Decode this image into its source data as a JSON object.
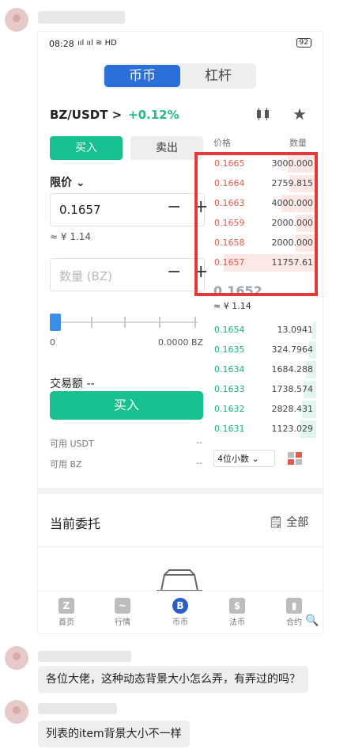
{
  "phone": {
    "status": {
      "time": "08:28",
      "signal": "ııl ııl ≋ HD",
      "battery": "92"
    },
    "segment": {
      "active": "币币",
      "inactive": "杠杆"
    },
    "pair": "BZ/USDT >",
    "change": "+0.12%",
    "icons": {
      "candle": "candlestick-icon",
      "star": "star-icon"
    },
    "trade": {
      "buy_tab": "买入",
      "sell_tab": "卖出",
      "order_type": "限价 ⌄",
      "price_value": "0.1657",
      "price_cny": "≈ ¥ 1.14",
      "qty_placeholder": "数量 (BZ)",
      "minus": "−",
      "plus": "+",
      "slider_min": "0",
      "slider_value": "0.0000 BZ",
      "amount_label": "交易额 --",
      "buy_button": "买入",
      "avail_usdt_label": "可用 USDT",
      "avail_usdt_value": "--",
      "avail_bz_label": "可用 BZ",
      "avail_bz_value": "--"
    },
    "orderbook": {
      "price_header": "价格",
      "qty_header": "数量",
      "asks": [
        {
          "price": "0.1665",
          "qty": "3000.000",
          "depth": 0.28
        },
        {
          "price": "0.1664",
          "qty": "2759.815",
          "depth": 0.26
        },
        {
          "price": "0.1663",
          "qty": "4000.000",
          "depth": 0.34
        },
        {
          "price": "0.1659",
          "qty": "2000.000",
          "depth": 0.2
        },
        {
          "price": "0.1658",
          "qty": "2000.000",
          "depth": 0.2
        },
        {
          "price": "0.1657",
          "qty": "11757.61",
          "depth": 0.9
        }
      ],
      "last_price": "0.1652",
      "last_cny": "≈ ¥ 1.14",
      "bids": [
        {
          "price": "0.1654",
          "qty": "13.0941",
          "depth": 0.04
        },
        {
          "price": "0.1635",
          "qty": "324.7964",
          "depth": 0.08
        },
        {
          "price": "0.1634",
          "qty": "1684.288",
          "depth": 0.1
        },
        {
          "price": "0.1633",
          "qty": "1738.574",
          "depth": 0.12
        },
        {
          "price": "0.1632",
          "qty": "2828.431",
          "depth": 0.14
        },
        {
          "price": "0.1631",
          "qty": "1123.029",
          "depth": 0.15
        }
      ],
      "decimals": "4位小数 ⌄"
    },
    "orders": {
      "title": "当前委托",
      "all": "全部"
    },
    "tabbar": [
      {
        "label": "首页",
        "glyph": "Z"
      },
      {
        "label": "行情",
        "glyph": "~"
      },
      {
        "label": "币币",
        "glyph": "B"
      },
      {
        "label": "法币",
        "glyph": "$"
      },
      {
        "label": "合约",
        "glyph": "▮"
      }
    ]
  },
  "chat": {
    "message1": "各位大佬，这种动态背景大小怎么弄，有弄过的吗？",
    "message2": "列表的item背景大小不一样"
  },
  "colors": {
    "green": "#17c08f",
    "red": "#e05a4e",
    "blue": "#2b6fd8",
    "highlight": "#e23a3a"
  }
}
